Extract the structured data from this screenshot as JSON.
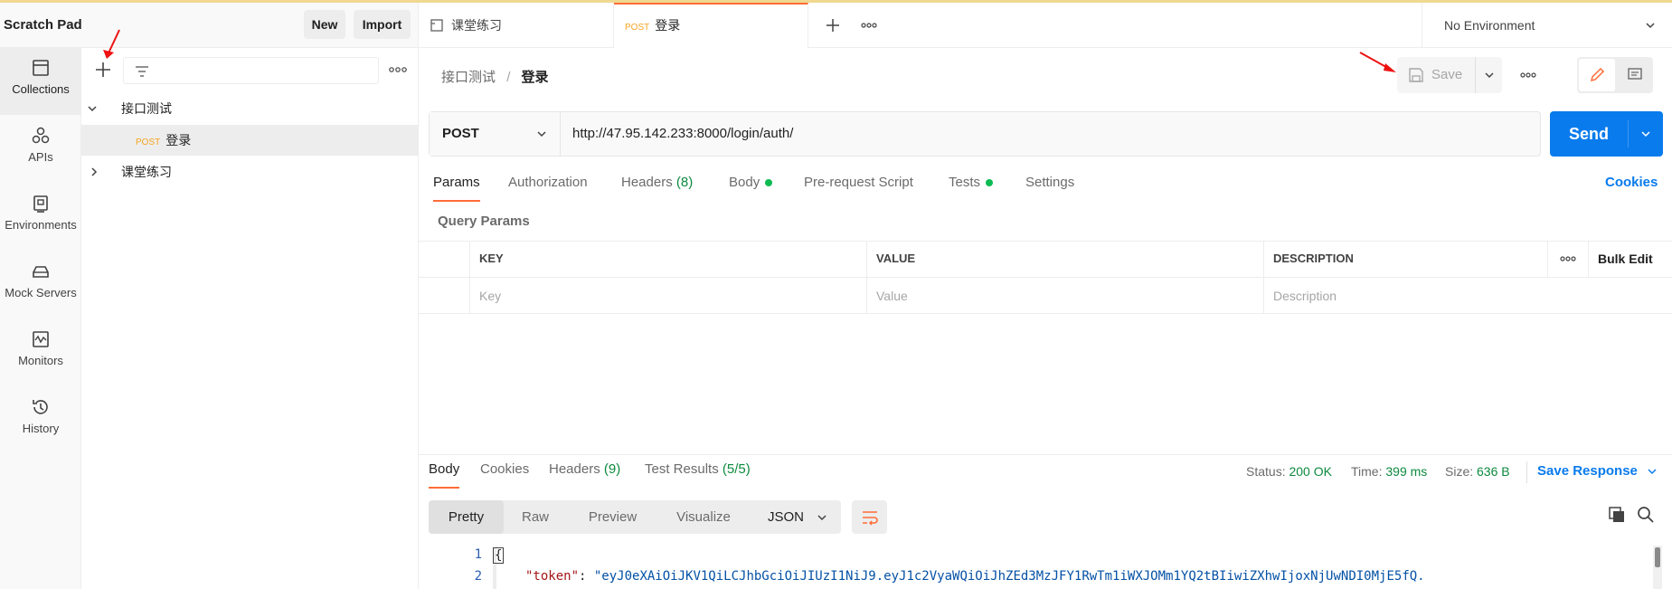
{
  "workspace": {
    "title": "Scratch Pad",
    "new_label": "New",
    "import_label": "Import"
  },
  "nav": [
    {
      "label": "Collections",
      "icon": "collections-icon",
      "active": true
    },
    {
      "label": "APIs",
      "icon": "apis-icon"
    },
    {
      "label": "Environments",
      "icon": "environments-icon"
    },
    {
      "label": "Mock Servers",
      "icon": "mock-servers-icon"
    },
    {
      "label": "Monitors",
      "icon": "monitors-icon"
    },
    {
      "label": "History",
      "icon": "history-icon"
    }
  ],
  "tree": {
    "folder1": "接口测试",
    "request_method": "POST",
    "request_name": "登录",
    "folder2": "课堂练习"
  },
  "tabs": {
    "tab1": "课堂练习",
    "tab2_method": "POST",
    "tab2_name": "登录",
    "environment": "No Environment"
  },
  "breadcrumb": {
    "parent": "接口测试",
    "sep": "/",
    "current": "登录"
  },
  "toolbar": {
    "save_label": "Save"
  },
  "request": {
    "method": "POST",
    "url": "http://47.95.142.233:8000/login/auth/",
    "send_label": "Send",
    "tabs": {
      "params": "Params",
      "authorization": "Authorization",
      "headers": "Headers",
      "headers_count": "(8)",
      "body": "Body",
      "prerequest": "Pre-request Script",
      "tests": "Tests",
      "settings": "Settings"
    },
    "cookies_link": "Cookies",
    "query_params_title": "Query Params",
    "columns": {
      "key": "KEY",
      "value": "VALUE",
      "description": "DESCRIPTION",
      "bulk_edit": "Bulk Edit"
    },
    "placeholders": {
      "key": "Key",
      "value": "Value",
      "description": "Description"
    }
  },
  "response": {
    "tabs": {
      "body": "Body",
      "cookies": "Cookies",
      "headers": "Headers",
      "headers_count": "(9)",
      "tests": "Test Results",
      "tests_count": "(5/5)"
    },
    "status_label": "Status:",
    "status_value": "200 OK",
    "time_label": "Time:",
    "time_value": "399 ms",
    "size_label": "Size:",
    "size_value": "636 B",
    "save_response": "Save Response",
    "views": [
      "Pretty",
      "Raw",
      "Preview",
      "Visualize"
    ],
    "format": "JSON",
    "lines": [
      {
        "num": "1",
        "text": "{"
      },
      {
        "num": "2",
        "key": "\"token\"",
        "colon": ": ",
        "value": "\"eyJ0eXAiOiJKV1QiLCJhbGciOiJIUzI1NiJ9.eyJ1c2VyaWQiOiJhZEd3MzJFY1RwTm1iWXJOMm1YQ2tBIiwiZXhwIjoxNjUwNDI0MjE5fQ."
      }
    ]
  },
  "colors": {
    "accent": "#ff6c37",
    "send": "#097bed",
    "success": "#0cbb52",
    "link": "#097bed",
    "annotation": "#ee1111"
  }
}
